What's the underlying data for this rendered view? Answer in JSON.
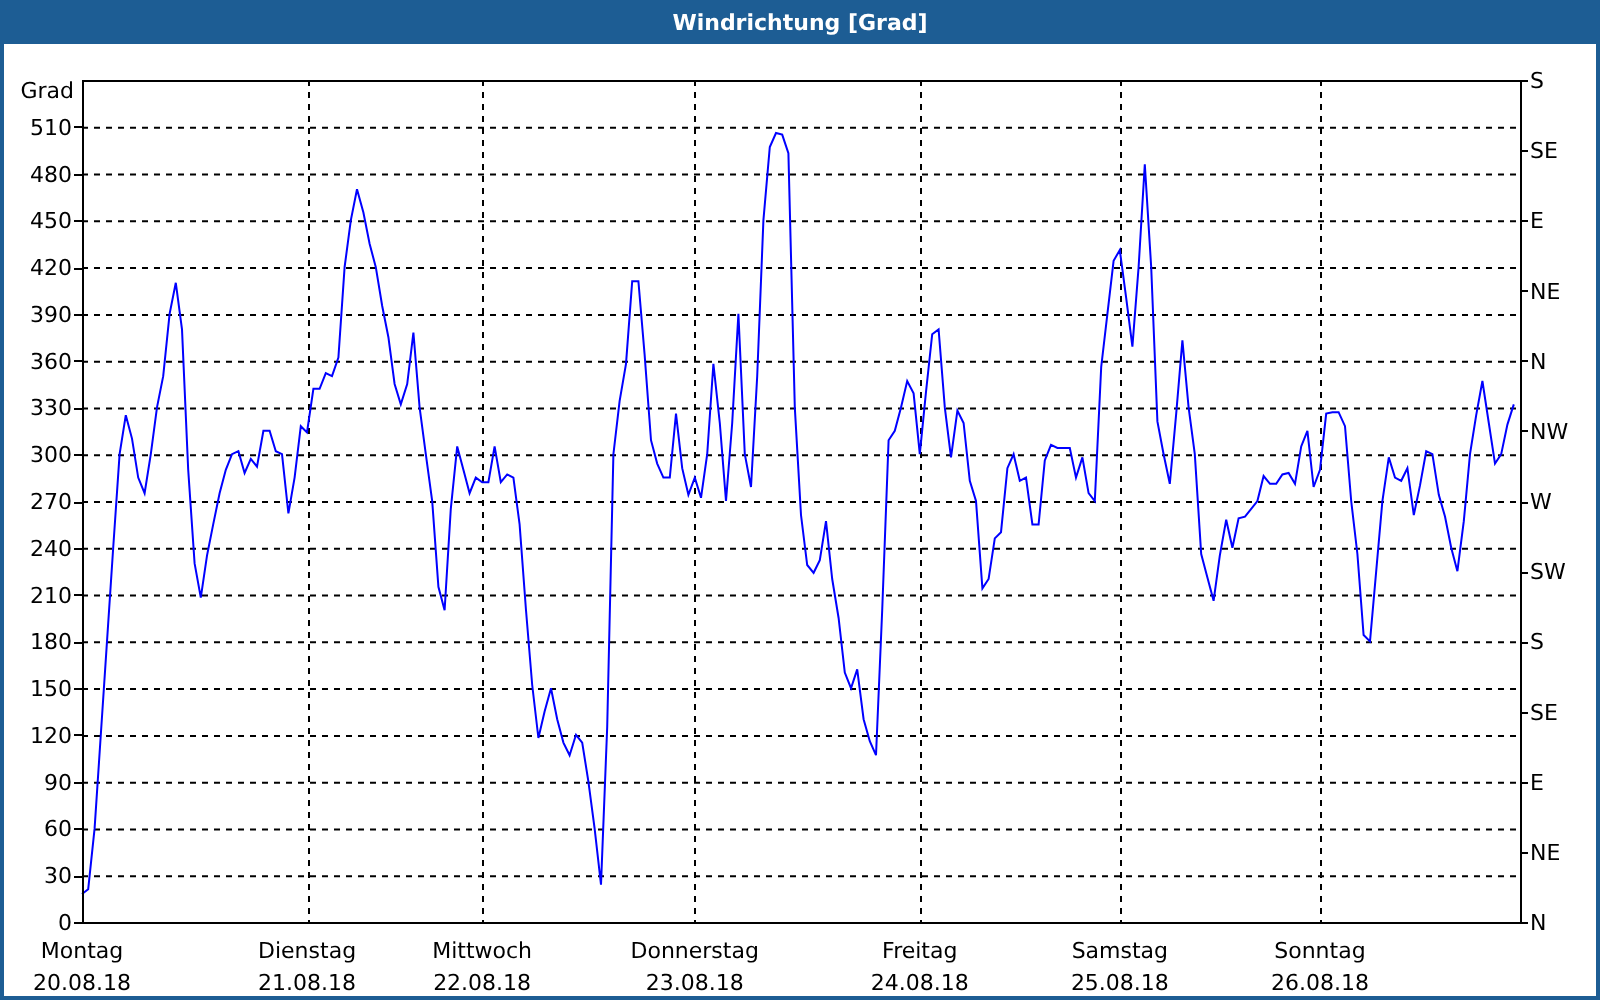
{
  "window": {
    "title": "Windrichtung [Grad]"
  },
  "chart": {
    "chart_data": {
      "type": "line",
      "grid": true,
      "ylabel": "Grad",
      "ylim": [
        0,
        540
      ],
      "categories": [
        "Montag",
        null,
        null,
        null,
        null,
        null,
        null,
        null,
        null,
        null,
        null,
        null,
        null,
        null,
        null,
        null,
        null,
        null,
        null,
        null,
        null,
        null,
        null,
        null,
        null,
        null,
        null,
        null,
        null,
        null,
        null,
        null,
        null,
        null,
        null,
        null,
        "Dienstag",
        null,
        null,
        null,
        null,
        null,
        null,
        null,
        null,
        null,
        null,
        null,
        null,
        null,
        null,
        null,
        null,
        null,
        null,
        null,
        null,
        null,
        null,
        null,
        null,
        null,
        null,
        null,
        "Mittwoch",
        null,
        null,
        null,
        null,
        null,
        null,
        null,
        null,
        null,
        null,
        null,
        null,
        null,
        null,
        null,
        null,
        null,
        null,
        null,
        null,
        null,
        null,
        null,
        null,
        null,
        null,
        null,
        null,
        null,
        null,
        null,
        null,
        null,
        "Donnerstag",
        null,
        null,
        null,
        null,
        null,
        null,
        null,
        null,
        null,
        null,
        null,
        null,
        null,
        null,
        null,
        null,
        null,
        null,
        null,
        null,
        null,
        null,
        null,
        null,
        null,
        null,
        null,
        null,
        null,
        null,
        null,
        null,
        null,
        null,
        null,
        "Freitag",
        null,
        null,
        null,
        null,
        null,
        null,
        null,
        null,
        null,
        null,
        null,
        null,
        null,
        null,
        null,
        null,
        null,
        null,
        null,
        null,
        null,
        null,
        null,
        null,
        null,
        null,
        null,
        null,
        null,
        null,
        null,
        "Samstag",
        null,
        null,
        null,
        null,
        null,
        null,
        null,
        null,
        null,
        null,
        null,
        null,
        null,
        null,
        null,
        null,
        null,
        null,
        null,
        null,
        null,
        null,
        null,
        null,
        null,
        null,
        null,
        null,
        null,
        null,
        null,
        "Sonntag",
        null,
        null,
        null,
        null,
        null,
        null,
        null,
        null,
        null,
        null,
        null,
        null,
        null,
        null,
        null,
        null,
        null,
        null,
        null,
        null,
        null,
        null,
        null,
        null,
        null,
        null,
        null,
        null,
        null,
        null,
        null
      ],
      "series": [
        {
          "color": "#0000ff",
          "values": [
            18,
            21,
            60,
            120,
            180,
            240,
            300,
            325,
            310,
            285,
            275,
            300,
            330,
            350,
            390,
            410,
            380,
            290,
            230,
            208,
            235,
            255,
            275,
            290,
            300,
            302,
            288,
            297,
            292,
            315,
            315,
            302,
            300,
            262,
            285,
            318,
            314,
            342,
            342,
            352,
            350,
            362,
            420,
            450,
            470,
            455,
            435,
            420,
            395,
            375,
            345,
            332,
            345,
            378,
            330,
            300,
            270,
            215,
            200,
            265,
            305,
            290,
            275,
            285,
            282,
            282,
            305,
            282,
            287,
            285,
            255,
            200,
            152,
            118,
            135,
            150,
            130,
            115,
            107,
            120,
            115,
            90,
            60,
            24,
            125,
            300,
            334,
            358,
            411,
            411,
            364,
            309,
            294,
            285,
            285,
            326,
            291,
            274,
            285,
            272,
            300,
            358,
            320,
            270,
            320,
            390,
            300,
            279,
            350,
            450,
            497,
            506,
            505,
            493,
            330,
            261,
            229,
            224,
            232,
            257,
            220,
            195,
            160,
            150,
            162,
            130,
            116,
            107,
            200,
            309,
            315,
            330,
            347,
            339,
            300,
            340,
            377,
            380,
            330,
            298,
            328,
            320,
            283,
            270,
            214,
            220,
            246,
            250,
            291,
            300,
            283,
            285,
            255,
            255,
            296,
            306,
            304,
            304,
            304,
            285,
            298,
            275,
            270,
            356,
            390,
            424,
            431,
            400,
            369,
            420,
            486,
            420,
            321,
            300,
            281,
            326,
            373,
            330,
            300,
            236,
            221,
            206,
            235,
            258,
            240,
            259,
            260,
            265,
            270,
            286,
            281,
            281,
            287,
            288,
            281,
            305,
            315,
            279,
            290,
            326,
            327,
            327,
            318,
            270,
            236,
            184,
            180,
            225,
            270,
            298,
            285,
            283,
            291,
            261,
            280,
            302,
            300,
            274,
            260,
            240,
            225,
            257,
            300,
            325,
            347,
            320,
            294,
            300,
            319,
            332
          ]
        }
      ],
      "yticks": [
        0,
        30,
        60,
        90,
        120,
        150,
        180,
        210,
        240,
        270,
        300,
        330,
        360,
        390,
        420,
        450,
        480,
        510
      ]
    },
    "dates": [
      "20.08.18",
      "21.08.18",
      "22.08.18",
      "23.08.18",
      "24.08.18",
      "25.08.18",
      "26.08.18"
    ],
    "direction_labels": [
      "S",
      "SE",
      "E",
      "NE",
      "N",
      "NW",
      "W",
      "SW",
      "S",
      "SE",
      "E",
      "NE",
      "N"
    ]
  }
}
